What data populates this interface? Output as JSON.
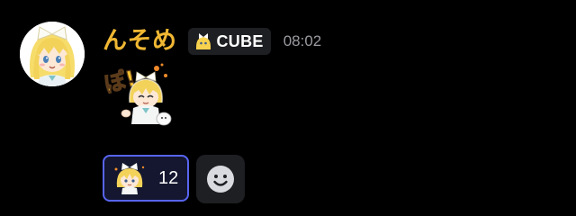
{
  "message": {
    "author": "んそめ",
    "tag": {
      "label": "CUBE",
      "icon": "cube-clan-icon"
    },
    "timestamp": "08:02",
    "avatar": "anime-girl-avatar",
    "sticker": "anime-girl-po-sticker",
    "sticker_text": "ぽ!"
  },
  "reactions": [
    {
      "emoji": "anime-girl-emoji",
      "count": "12",
      "selected": true
    }
  ],
  "add_reaction": {
    "icon": "smiley-face-icon"
  },
  "colors": {
    "background": "#000000",
    "username": "#f0b733",
    "tag_background": "#1e1f22",
    "reaction_selected_border": "#5865f2",
    "reaction_selected_background": "#14172f",
    "timestamp": "#9a9ba1"
  }
}
